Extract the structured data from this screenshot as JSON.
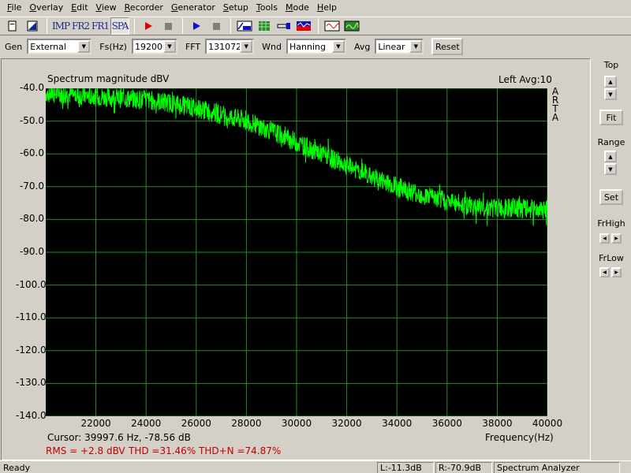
{
  "menu": [
    "File",
    "Overlay",
    "Edit",
    "View",
    "Recorder",
    "Generator",
    "Setup",
    "Tools",
    "Mode",
    "Help"
  ],
  "toolbar": {
    "imp": "IMP",
    "fr2": "FR2",
    "fr1": "FR1",
    "spa": "SPA",
    "buttons": [
      "new-icon",
      "open-icon",
      "impulse-mode",
      "freq-response-2ch",
      "freq-response-1ch",
      "spectrum-mode",
      "record-icon",
      "stop-icon",
      "play-icon",
      "stop-icon",
      "label-abc-icon",
      "grid-icon",
      "zoom-icon",
      "color-icon",
      "generator-sine-icon",
      "spectrum-view-icon"
    ]
  },
  "controls": {
    "gen_label": "Gen",
    "gen_value": "External",
    "fs_label": "Fs(Hz)",
    "fs_value": "192000",
    "fft_label": "FFT",
    "fft_value": "131072",
    "wnd_label": "Wnd",
    "wnd_value": "Hanning",
    "avg_label": "Avg",
    "avg_value": "Linear",
    "reset": "Reset"
  },
  "plot": {
    "title": "Spectrum magnitude dBV",
    "right_label": "Left  Avg:10",
    "watermark": "ARTA",
    "xlabel": "Frequency(Hz)",
    "cursor": "Cursor: 39997.6 Hz, -78.56 dB",
    "rms": "RMS =   +2.8 dBV",
    "thd": "THD =31.46%",
    "thdn": "THD+N =74.87%",
    "trace_color": "#00ff00",
    "grid_color": "#1f8f1f",
    "background": "#000000",
    "ytick_labels": [
      "-40.0",
      "-50.0",
      "-60.0",
      "-70.0",
      "-80.0",
      "-90.0",
      "-100.0",
      "-110.0",
      "-120.0",
      "-130.0",
      "-140.0"
    ],
    "xtick_labels": [
      "22000",
      "24000",
      "26000",
      "28000",
      "30000",
      "32000",
      "34000",
      "36000",
      "38000",
      "40000"
    ]
  },
  "chart_data": {
    "type": "line",
    "title": "Spectrum magnitude dBV",
    "xlabel": "Frequency(Hz)",
    "ylabel": "",
    "xlim": [
      20000,
      40000
    ],
    "ylim": [
      -140,
      -40
    ],
    "xticks": [
      22000,
      24000,
      26000,
      28000,
      30000,
      32000,
      34000,
      36000,
      38000,
      40000
    ],
    "yticks": [
      -40,
      -50,
      -60,
      -70,
      -80,
      -90,
      -100,
      -110,
      -120,
      -130,
      -140
    ],
    "grid": true,
    "series": [
      {
        "color": "#00ff00",
        "x": [
          20000,
          21000,
          22000,
          23000,
          24000,
          25000,
          26000,
          27000,
          28000,
          29000,
          30000,
          31000,
          32000,
          33000,
          34000,
          35000,
          36000,
          37000,
          38000,
          39000,
          40000
        ],
        "y": [
          -41.5,
          -42,
          -42.5,
          -43,
          -43.5,
          -44.5,
          -46,
          -48,
          -50,
          -53,
          -56.5,
          -60,
          -63.5,
          -67,
          -70,
          -72.5,
          -74.5,
          -76,
          -76.5,
          -76.8,
          -77
        ]
      }
    ]
  },
  "side": {
    "top": "Top",
    "fit": "Fit",
    "range": "Range",
    "set": "Set",
    "frhigh": "FrHigh",
    "frlow": "FrLow"
  },
  "status": {
    "ready": "Ready",
    "left": "L:-11.3dB",
    "right": "R:-70.9dB",
    "mode": "Spectrum Analyzer"
  }
}
